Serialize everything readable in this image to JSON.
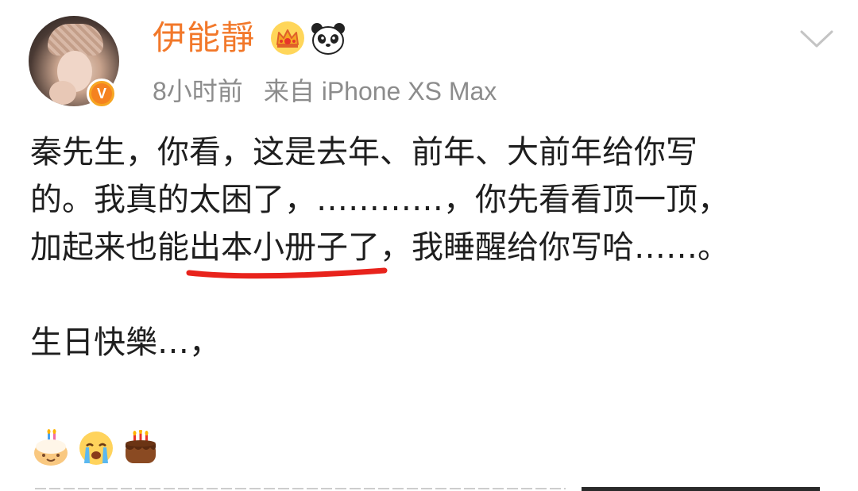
{
  "post": {
    "author": {
      "name": "伊能靜",
      "verified_mark": "V",
      "badges": [
        "crown-icon",
        "panda-icon"
      ]
    },
    "meta": {
      "time": "8小时前",
      "source": "来自 iPhone XS Max"
    },
    "menu_icon": "chevron-down-icon",
    "body": {
      "line1": "秦先生，你看，这是去年、前年、大前年给你写",
      "line2": "的。我真的太困了，…………，你先看看顶一顶，",
      "line3_prefix": "加起来也能",
      "line3_highlight": "出本小册子了",
      "line3_suffix": "，我睡醒给你写哈……。",
      "line4": "生日快樂…，"
    },
    "emojis": [
      "birthday-cake-icon",
      "crying-face-icon",
      "cake-icon"
    ],
    "colors": {
      "username": "#f2782a",
      "meta_text": "#8c8c8c",
      "body_text": "#1e1e1e",
      "underline_mark": "#e8231c",
      "verified_badge": "#f58220"
    }
  }
}
